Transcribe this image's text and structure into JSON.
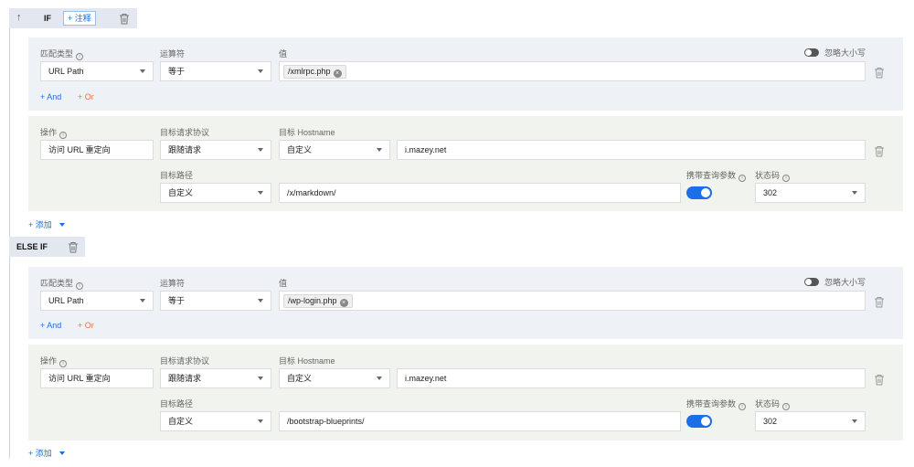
{
  "if_block": {
    "label": "IF",
    "comment_button": "+ 注释",
    "match": {
      "match_type_label": "匹配类型",
      "operator_label": "运算符",
      "value_label": "值",
      "ignore_case_label": "忽略大小写",
      "match_type": "URL Path",
      "operator": "等于",
      "value_tag": "/xmlrpc.php",
      "add_and": "+ And",
      "add_or": "+ Or"
    },
    "action": {
      "op_label": "操作",
      "protocol_label": "目标请求协议",
      "hostname_label": "目标 Hostname",
      "op_value": "访问 URL 重定向",
      "protocol_value": "跟随请求",
      "host_mode": "自定义",
      "host_value": "i.mazey.net",
      "path_label": "目标路径",
      "path_mode": "自定义",
      "path_value": "/x/markdown/",
      "carry_query_label": "携带查询参数",
      "status_label": "状态码",
      "status_value": "302"
    },
    "add_more": "+ 添加"
  },
  "else_if_block": {
    "label": "ELSE IF",
    "match": {
      "match_type_label": "匹配类型",
      "operator_label": "运算符",
      "value_label": "值",
      "ignore_case_label": "忽略大小写",
      "match_type": "URL Path",
      "operator": "等于",
      "value_tag": "/wp-login.php",
      "add_and": "+ And",
      "add_or": "+ Or"
    },
    "action": {
      "op_label": "操作",
      "protocol_label": "目标请求协议",
      "hostname_label": "目标 Hostname",
      "op_value": "访问 URL 重定向",
      "protocol_value": "跟随请求",
      "host_mode": "自定义",
      "host_value": "i.mazey.net",
      "path_label": "目标路径",
      "path_mode": "自定义",
      "path_value": "/bootstrap-blueprints/",
      "carry_query_label": "携带查询参数",
      "status_label": "状态码",
      "status_value": "302"
    },
    "add_more": "+ 添加"
  },
  "colors": {
    "accent": "#1a6ee8",
    "or": "#e8734a",
    "match_bg": "#eef1f6",
    "action_bg": "#f1f3ee"
  }
}
